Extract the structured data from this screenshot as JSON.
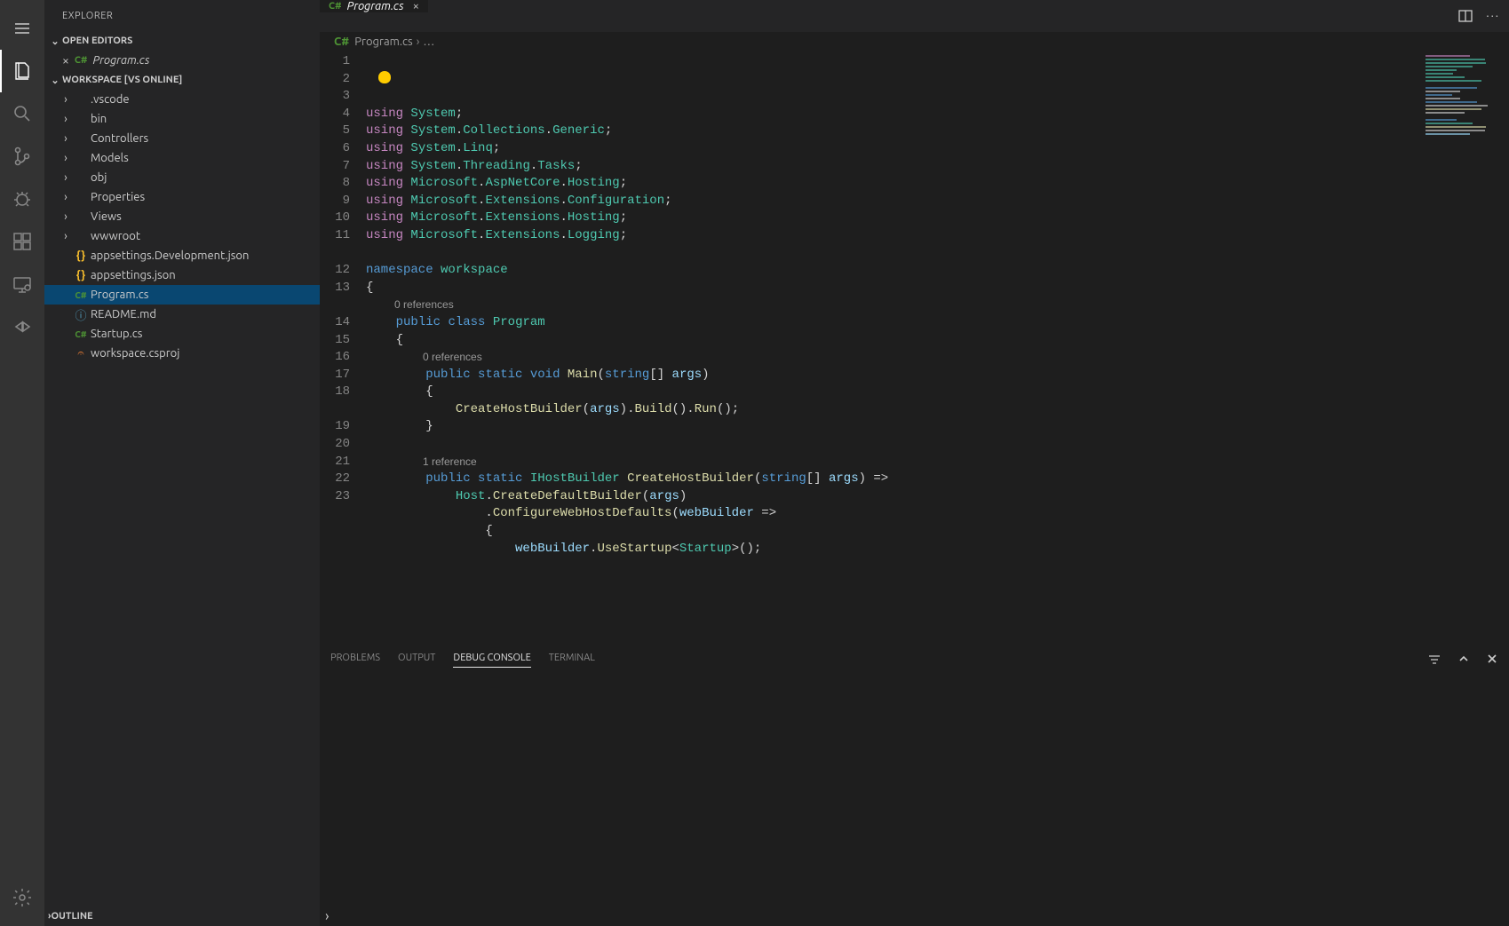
{
  "sidebar": {
    "title": "EXPLORER",
    "open_editors_label": "OPEN EDITORS",
    "workspace_label": "WORKSPACE [VS ONLINE]",
    "outline_label": "OUTLINE",
    "open_editors": [
      {
        "name": "Program.cs",
        "icon": "cs"
      }
    ],
    "tree": [
      {
        "name": ".vscode",
        "kind": "folder"
      },
      {
        "name": "bin",
        "kind": "folder"
      },
      {
        "name": "Controllers",
        "kind": "folder"
      },
      {
        "name": "Models",
        "kind": "folder"
      },
      {
        "name": "obj",
        "kind": "folder"
      },
      {
        "name": "Properties",
        "kind": "folder"
      },
      {
        "name": "Views",
        "kind": "folder"
      },
      {
        "name": "wwwroot",
        "kind": "folder"
      },
      {
        "name": "appsettings.Development.json",
        "kind": "file",
        "icon": "json"
      },
      {
        "name": "appsettings.json",
        "kind": "file",
        "icon": "json"
      },
      {
        "name": "Program.cs",
        "kind": "file",
        "icon": "cs",
        "active": true
      },
      {
        "name": "README.md",
        "kind": "file",
        "icon": "md"
      },
      {
        "name": "Startup.cs",
        "kind": "file",
        "icon": "cs"
      },
      {
        "name": "workspace.csproj",
        "kind": "file",
        "icon": "xml"
      }
    ]
  },
  "tabs": {
    "items": [
      {
        "name": "Program.cs",
        "icon": "cs"
      }
    ]
  },
  "breadcrumbs": {
    "file": "Program.cs",
    "more": "…"
  },
  "code": {
    "lines": [
      {
        "n": 1,
        "t": [
          [
            "kw",
            "using"
          ],
          [
            "punc",
            " "
          ],
          [
            "cls",
            "System"
          ],
          [
            "punc",
            ";"
          ]
        ]
      },
      {
        "n": 2,
        "t": [
          [
            "kw",
            "using"
          ],
          [
            "punc",
            " "
          ],
          [
            "cls",
            "System"
          ],
          [
            "punc",
            "."
          ],
          [
            "cls",
            "Collections"
          ],
          [
            "punc",
            "."
          ],
          [
            "cls",
            "Generic"
          ],
          [
            "punc",
            ";"
          ]
        ]
      },
      {
        "n": 3,
        "t": [
          [
            "kw",
            "using"
          ],
          [
            "punc",
            " "
          ],
          [
            "cls",
            "System"
          ],
          [
            "punc",
            "."
          ],
          [
            "cls",
            "Linq"
          ],
          [
            "punc",
            ";"
          ]
        ]
      },
      {
        "n": 4,
        "t": [
          [
            "kw",
            "using"
          ],
          [
            "punc",
            " "
          ],
          [
            "cls",
            "System"
          ],
          [
            "punc",
            "."
          ],
          [
            "cls",
            "Threading"
          ],
          [
            "punc",
            "."
          ],
          [
            "cls",
            "Tasks"
          ],
          [
            "punc",
            ";"
          ]
        ]
      },
      {
        "n": 5,
        "t": [
          [
            "kw",
            "using"
          ],
          [
            "punc",
            " "
          ],
          [
            "cls",
            "Microsoft"
          ],
          [
            "punc",
            "."
          ],
          [
            "cls",
            "AspNetCore"
          ],
          [
            "punc",
            "."
          ],
          [
            "cls",
            "Hosting"
          ],
          [
            "punc",
            ";"
          ]
        ]
      },
      {
        "n": 6,
        "t": [
          [
            "kw",
            "using"
          ],
          [
            "punc",
            " "
          ],
          [
            "cls",
            "Microsoft"
          ],
          [
            "punc",
            "."
          ],
          [
            "cls",
            "Extensions"
          ],
          [
            "punc",
            "."
          ],
          [
            "cls",
            "Configuration"
          ],
          [
            "punc",
            ";"
          ]
        ]
      },
      {
        "n": 7,
        "t": [
          [
            "kw",
            "using"
          ],
          [
            "punc",
            " "
          ],
          [
            "cls",
            "Microsoft"
          ],
          [
            "punc",
            "."
          ],
          [
            "cls",
            "Extensions"
          ],
          [
            "punc",
            "."
          ],
          [
            "cls",
            "Hosting"
          ],
          [
            "punc",
            ";"
          ]
        ]
      },
      {
        "n": 8,
        "t": [
          [
            "kw",
            "using"
          ],
          [
            "punc",
            " "
          ],
          [
            "cls",
            "Microsoft"
          ],
          [
            "punc",
            "."
          ],
          [
            "cls",
            "Extensions"
          ],
          [
            "punc",
            "."
          ],
          [
            "cls",
            "Logging"
          ],
          [
            "punc",
            ";"
          ]
        ]
      },
      {
        "n": 9,
        "t": []
      },
      {
        "n": 10,
        "t": [
          [
            "type",
            "namespace"
          ],
          [
            "punc",
            " "
          ],
          [
            "cls",
            "workspace"
          ]
        ]
      },
      {
        "n": 11,
        "t": [
          [
            "punc",
            "{"
          ]
        ]
      },
      {
        "codelens": "0 references",
        "indent": 4
      },
      {
        "n": 12,
        "t": [
          [
            "punc",
            "    "
          ],
          [
            "type",
            "public"
          ],
          [
            "punc",
            " "
          ],
          [
            "type",
            "class"
          ],
          [
            "punc",
            " "
          ],
          [
            "cls",
            "Program"
          ]
        ]
      },
      {
        "n": 13,
        "t": [
          [
            "punc",
            "    {"
          ]
        ]
      },
      {
        "codelens": "0 references",
        "indent": 8
      },
      {
        "n": 14,
        "t": [
          [
            "punc",
            "        "
          ],
          [
            "type",
            "public"
          ],
          [
            "punc",
            " "
          ],
          [
            "type",
            "static"
          ],
          [
            "punc",
            " "
          ],
          [
            "type",
            "void"
          ],
          [
            "punc",
            " "
          ],
          [
            "mth",
            "Main"
          ],
          [
            "punc",
            "("
          ],
          [
            "type",
            "string"
          ],
          [
            "punc",
            "[] "
          ],
          [
            "var",
            "args"
          ],
          [
            "punc",
            ")"
          ]
        ]
      },
      {
        "n": 15,
        "t": [
          [
            "punc",
            "        {"
          ]
        ]
      },
      {
        "n": 16,
        "t": [
          [
            "punc",
            "            "
          ],
          [
            "mth",
            "CreateHostBuilder"
          ],
          [
            "punc",
            "("
          ],
          [
            "var",
            "args"
          ],
          [
            "punc",
            ")."
          ],
          [
            "mth",
            "Build"
          ],
          [
            "punc",
            "()."
          ],
          [
            "mth",
            "Run"
          ],
          [
            "punc",
            "();"
          ]
        ]
      },
      {
        "n": 17,
        "t": [
          [
            "punc",
            "        }"
          ]
        ]
      },
      {
        "n": 18,
        "t": []
      },
      {
        "codelens": "1 reference",
        "indent": 8
      },
      {
        "n": 19,
        "t": [
          [
            "punc",
            "        "
          ],
          [
            "type",
            "public"
          ],
          [
            "punc",
            " "
          ],
          [
            "type",
            "static"
          ],
          [
            "punc",
            " "
          ],
          [
            "cls",
            "IHostBuilder"
          ],
          [
            "punc",
            " "
          ],
          [
            "mth",
            "CreateHostBuilder"
          ],
          [
            "punc",
            "("
          ],
          [
            "type",
            "string"
          ],
          [
            "punc",
            "[] "
          ],
          [
            "var",
            "args"
          ],
          [
            "punc",
            ") =>"
          ]
        ]
      },
      {
        "n": 20,
        "t": [
          [
            "punc",
            "            "
          ],
          [
            "cls",
            "Host"
          ],
          [
            "punc",
            "."
          ],
          [
            "mth",
            "CreateDefaultBuilder"
          ],
          [
            "punc",
            "("
          ],
          [
            "var",
            "args"
          ],
          [
            "punc",
            ")"
          ]
        ]
      },
      {
        "n": 21,
        "t": [
          [
            "punc",
            "                ."
          ],
          [
            "mth",
            "ConfigureWebHostDefaults"
          ],
          [
            "punc",
            "("
          ],
          [
            "var",
            "webBuilder"
          ],
          [
            "punc",
            " =>"
          ]
        ]
      },
      {
        "n": 22,
        "t": [
          [
            "punc",
            "                {"
          ]
        ]
      },
      {
        "n": 23,
        "t": [
          [
            "punc",
            "                    "
          ],
          [
            "var",
            "webBuilder"
          ],
          [
            "punc",
            "."
          ],
          [
            "mth",
            "UseStartup"
          ],
          [
            "punc",
            "<"
          ],
          [
            "cls",
            "Startup"
          ],
          [
            "punc",
            ">();"
          ]
        ]
      }
    ]
  },
  "panel": {
    "tabs": [
      "PROBLEMS",
      "OUTPUT",
      "DEBUG CONSOLE",
      "TERMINAL"
    ],
    "active": 2
  }
}
